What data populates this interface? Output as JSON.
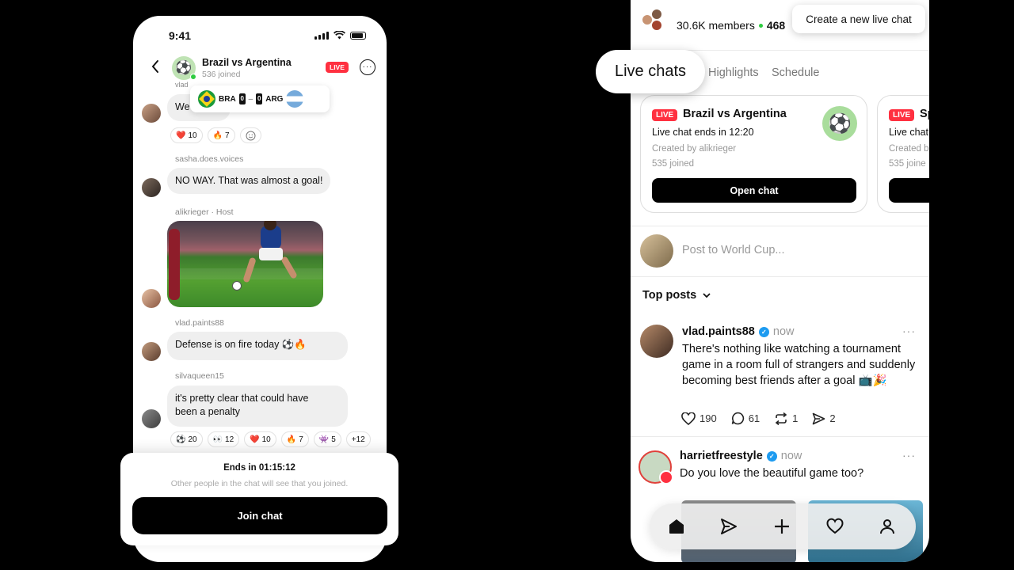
{
  "left_phone": {
    "status_time": "9:41",
    "header": {
      "title": "Brazil vs Argentina",
      "subtitle": "536 joined",
      "live_label": "LIVE"
    },
    "score": {
      "home_code": "BRA",
      "home_score": "0",
      "separator": "–",
      "away_score": "0",
      "away_code": "ARG"
    },
    "messages": [
      {
        "author": "vlad",
        "text": "We",
        "reactions": [
          {
            "emoji": "❤️",
            "count": "10"
          },
          {
            "emoji": "🔥",
            "count": "7"
          }
        ]
      },
      {
        "author": "sasha.does.voices",
        "text": "NO WAY. That was almost a goal!"
      },
      {
        "author": "alikrieger · Host",
        "text": ""
      },
      {
        "author": "vlad.paints88",
        "text": "Defense is on fire today ⚽🔥"
      },
      {
        "author": "silvaqueen15",
        "text_line1": "it's pretty clear that could have",
        "text_line2": "been a penalty",
        "reactions": [
          {
            "emoji": "⚽",
            "count": "20"
          },
          {
            "emoji": "👀",
            "count": "12"
          },
          {
            "emoji": "❤️",
            "count": "10"
          },
          {
            "emoji": "🔥",
            "count": "7"
          },
          {
            "emoji": "👾",
            "count": "5"
          }
        ],
        "more": "+12"
      }
    ],
    "join_card": {
      "title": "Ends in 01:15:12",
      "subtitle": "Other people in the chat will see that you joined.",
      "button": "Join chat"
    }
  },
  "right_phone": {
    "members": "30.6K members",
    "online": "468",
    "new_chat_button": "Create a new live chat",
    "tabs": {
      "active": "Live chats",
      "t2": "Highlights",
      "t3": "Schedule"
    },
    "live_cards": [
      {
        "live": "LIVE",
        "title": "Brazil vs Argentina",
        "ends": "Live chat ends in 12:20",
        "by": "Created by alikrieger",
        "joined": "535 joined",
        "button": "Open chat"
      },
      {
        "live": "LIVE",
        "title": "Sp",
        "ends": "Live chat",
        "by": "Created b",
        "joined": "535 joine",
        "button": ""
      }
    ],
    "composer_placeholder": "Post to World Cup...",
    "sort_label": "Top posts",
    "posts": [
      {
        "user": "vlad.paints88",
        "time": "now",
        "text": "There's nothing like watching a tournament game in a room full of strangers and suddenly becoming best friends after a goal 📺🎉",
        "likes": "190",
        "comments": "61",
        "reposts": "1",
        "shares": "2"
      },
      {
        "user": "harrietfreestyle",
        "time": "now",
        "text": "Do you love the beautiful game too?"
      }
    ]
  },
  "colors": {
    "live_red": "#ff3040",
    "verified_blue": "#1d9bf0",
    "online_green": "#2ecc40"
  }
}
